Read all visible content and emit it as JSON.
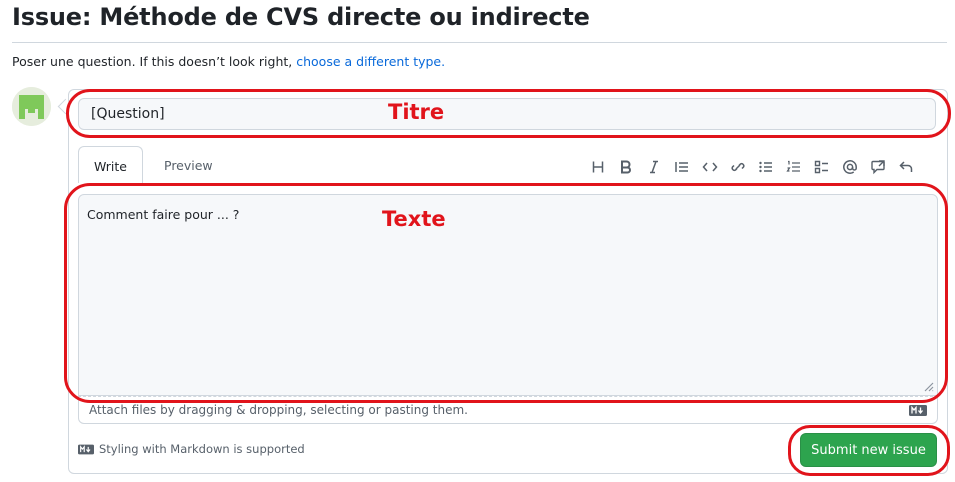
{
  "page": {
    "title": "Issue: Méthode de CVS directe ou indirecte",
    "subtitle_prefix": "Poser une question. If this doesn’t look right,",
    "subtitle_link": "choose a different type."
  },
  "form": {
    "title_value": "[Question]",
    "tabs": [
      {
        "label": "Write",
        "active": true
      },
      {
        "label": "Preview",
        "active": false
      }
    ],
    "toolbar_icons": [
      "heading-icon",
      "bold-icon",
      "italic-icon",
      "quote-icon",
      "code-icon",
      "link-icon",
      "unordered-list-icon",
      "ordered-list-icon",
      "task-list-icon",
      "mention-icon",
      "reference-icon",
      "undo-icon"
    ],
    "body_value": "Comment faire pour ... ?",
    "attach_hint": "Attach files by dragging & dropping, selecting or pasting them.",
    "markdown_note": "Styling with Markdown is supported",
    "submit_label": "Submit new issue"
  },
  "annotations": {
    "title_label": "Titre",
    "text_label": "Texte",
    "color": "#e1141b"
  },
  "colors": {
    "submit_bg": "#2da44e",
    "link": "#0969da"
  }
}
